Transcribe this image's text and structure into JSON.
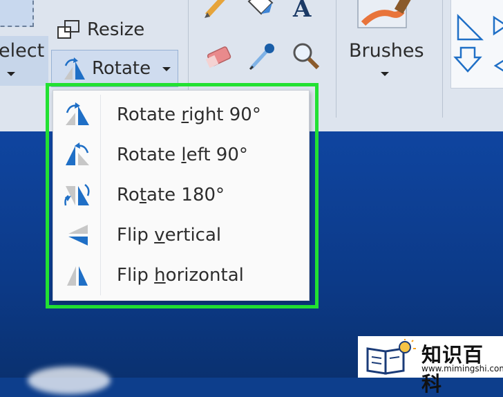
{
  "ribbon": {
    "select_label": "elect",
    "resize_label": "Resize",
    "rotate_label": "Rotate",
    "brushes_label": "Brushes"
  },
  "rotate_menu": {
    "items": [
      {
        "before": "Rotate ",
        "accel": "r",
        "after": "ight 90°",
        "icon": "rotate-right-icon"
      },
      {
        "before": "Rotate ",
        "accel": "l",
        "after": "eft 90°",
        "icon": "rotate-left-icon"
      },
      {
        "before": "Ro",
        "accel": "t",
        "after": "ate 180°",
        "icon": "rotate-180-icon"
      },
      {
        "before": "Flip ",
        "accel": "v",
        "after": "ertical",
        "icon": "flip-vertical-icon"
      },
      {
        "before": "Flip ",
        "accel": "h",
        "after": "orizontal",
        "icon": "flip-horizontal-icon"
      }
    ],
    "highlight_color": "#22e132"
  },
  "watermark": {
    "title": "知识百科",
    "url": "www.mimingshi.com"
  },
  "colors": {
    "ribbon_bg": "#dde4ee",
    "desktop_bg": "#0d3e8c",
    "accent_blue": "#1e6fc4"
  }
}
